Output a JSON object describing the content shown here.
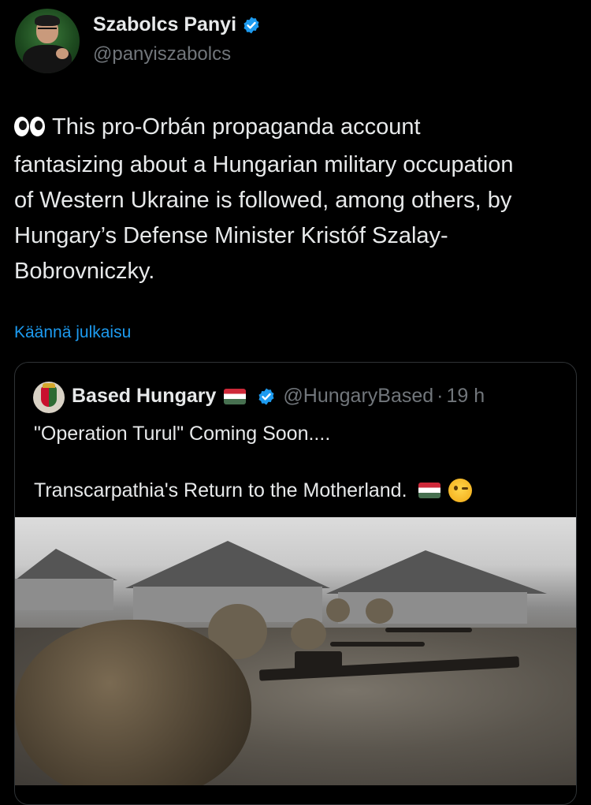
{
  "tweet": {
    "author": {
      "name": "Szabolcs Panyi",
      "handle": "@panyiszabolcs",
      "verified": true
    },
    "emoji": "eyes",
    "text": "This pro-Orbán propaganda account\nfantasizing about a Hungarian military occupation\nof Western Ukraine is followed, among others, by\nHungary’s Defense Minister Kristóf Szalay-\nBobrovniczky.",
    "translate_label": "Käännä julkaisu"
  },
  "quote": {
    "author": {
      "name": "Based Hungary",
      "handle": "@HungaryBased",
      "verified": true
    },
    "separator": "·",
    "time": "19 h",
    "line1": "\"Operation Turul\" Coming Soon....",
    "line2": "Transcarpathia's Return to the Motherland.",
    "emojis": [
      "hungary-flag",
      "winking-face"
    ]
  },
  "colors": {
    "background": "#000000",
    "text": "#e7e9ea",
    "secondary": "#71767b",
    "link": "#1d9bf0",
    "verified": "#1d9bf0",
    "border": "#2f3336"
  }
}
